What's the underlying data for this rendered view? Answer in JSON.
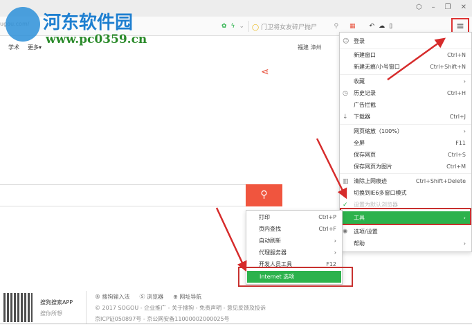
{
  "watermark": {
    "title": "河东软件园",
    "url": "www.pc0359.cn"
  },
  "titlebar": {
    "buttons": [
      "⬡",
      "–",
      "❐",
      "✕"
    ]
  },
  "toolbar": {
    "address": "ugou.com/",
    "search_placeholder": "门卫将女友碎尸抛尸",
    "menu_icon": "≡"
  },
  "nav": {
    "items": [
      "学术",
      "更多▾"
    ],
    "weather": "福建 漳州"
  },
  "menu": {
    "items": [
      {
        "label": "登录",
        "shortcut": "",
        "icon": "user-icon"
      },
      {
        "label": "新建窗口",
        "shortcut": "Ctrl+N"
      },
      {
        "label": "新建无痕/小号窗口",
        "shortcut": "Ctrl+Shift+N"
      },
      {
        "label": "收藏",
        "shortcut": "›"
      },
      {
        "label": "历史记录",
        "shortcut": "Ctrl+H",
        "icon": "history-icon"
      },
      {
        "label": "广告拦截",
        "shortcut": ""
      },
      {
        "label": "下载器",
        "shortcut": "Ctrl+J",
        "icon": "download-icon"
      },
      {
        "label": "网页缩放（100%）",
        "shortcut": "›"
      },
      {
        "label": "全屏",
        "shortcut": "F11"
      },
      {
        "label": "保存网页",
        "shortcut": "Ctrl+S"
      },
      {
        "label": "保存网页为图片",
        "shortcut": "Ctrl+M"
      },
      {
        "label": "清除上网痕迹",
        "shortcut": "Ctrl+Shift+Delete",
        "icon": "trash-icon"
      },
      {
        "label": "切换到IE6多窗口模式",
        "shortcut": ""
      },
      {
        "label": "设置为默认浏览器",
        "shortcut": "",
        "icon": "check-icon",
        "disabled": true
      },
      {
        "label": "工具",
        "shortcut": "›",
        "selected": true
      },
      {
        "label": "选项/设置",
        "shortcut": "",
        "icon": "gear-icon"
      },
      {
        "label": "帮助",
        "shortcut": "›"
      }
    ]
  },
  "submenu": {
    "items": [
      {
        "label": "打印",
        "shortcut": "Ctrl+P"
      },
      {
        "label": "页内查找",
        "shortcut": "Ctrl+F"
      },
      {
        "label": "自动刷新",
        "shortcut": "›"
      },
      {
        "label": "代理服务器",
        "shortcut": "›"
      },
      {
        "label": "开发人员工具",
        "shortcut": "F12"
      },
      {
        "label": "Internet 选项",
        "shortcut": "",
        "selected": true
      }
    ]
  },
  "footer": {
    "app_title": "搜狗搜索APP",
    "app_sub": "搜你所想",
    "links": [
      "® 搜狗输入法",
      "Ⓢ 浏览器",
      "⊕ 网址导航"
    ],
    "copyright": "© 2017 SOGOU - 企业推广 - 关于搜狗 - 免责声明 - 意见反馈及投诉",
    "icp": "京ICP证050897号 - 京公网安备11000002000025号"
  },
  "colors": {
    "accent": "#2cb24c",
    "highlight": "#c8312f",
    "search": "#f0553e"
  }
}
